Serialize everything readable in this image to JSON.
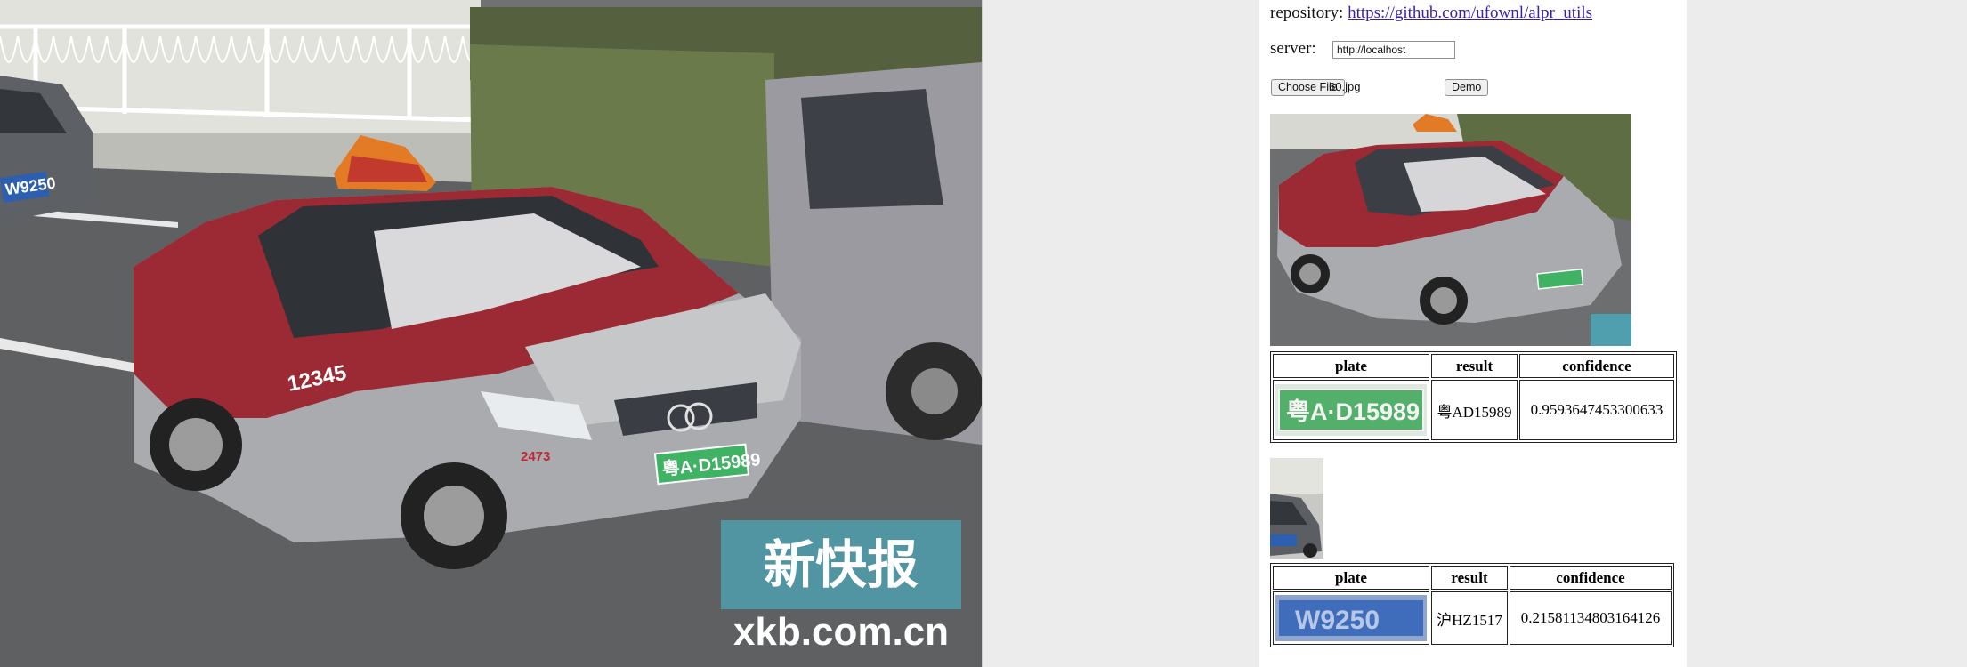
{
  "page": {
    "repository_label": "repository:",
    "repository_link": "https://github.com/ufownl/alpr_utils",
    "server_label": "server:",
    "server_value": "http://localhost",
    "choose_file_label": "Choose File",
    "file_name": "60.jpg",
    "demo_label": "Demo"
  },
  "results": [
    {
      "headers": [
        "plate",
        "result",
        "confidence"
      ],
      "result": "粤AD15989",
      "confidence": "0.9593647453300633",
      "plate_text": "粤A·D15989"
    },
    {
      "headers": [
        "plate",
        "result",
        "confidence"
      ],
      "result": "沪HZ1517",
      "confidence": "0.21581134803164126",
      "plate_text": "W9250"
    }
  ],
  "photo": {
    "taxi_plate": "粤A·D15989",
    "left_car_plate": "W9250",
    "door_number": "12345",
    "fender_number": "2473",
    "watermark_cn": "新快报",
    "watermark_url": "xkb.com.cn"
  }
}
